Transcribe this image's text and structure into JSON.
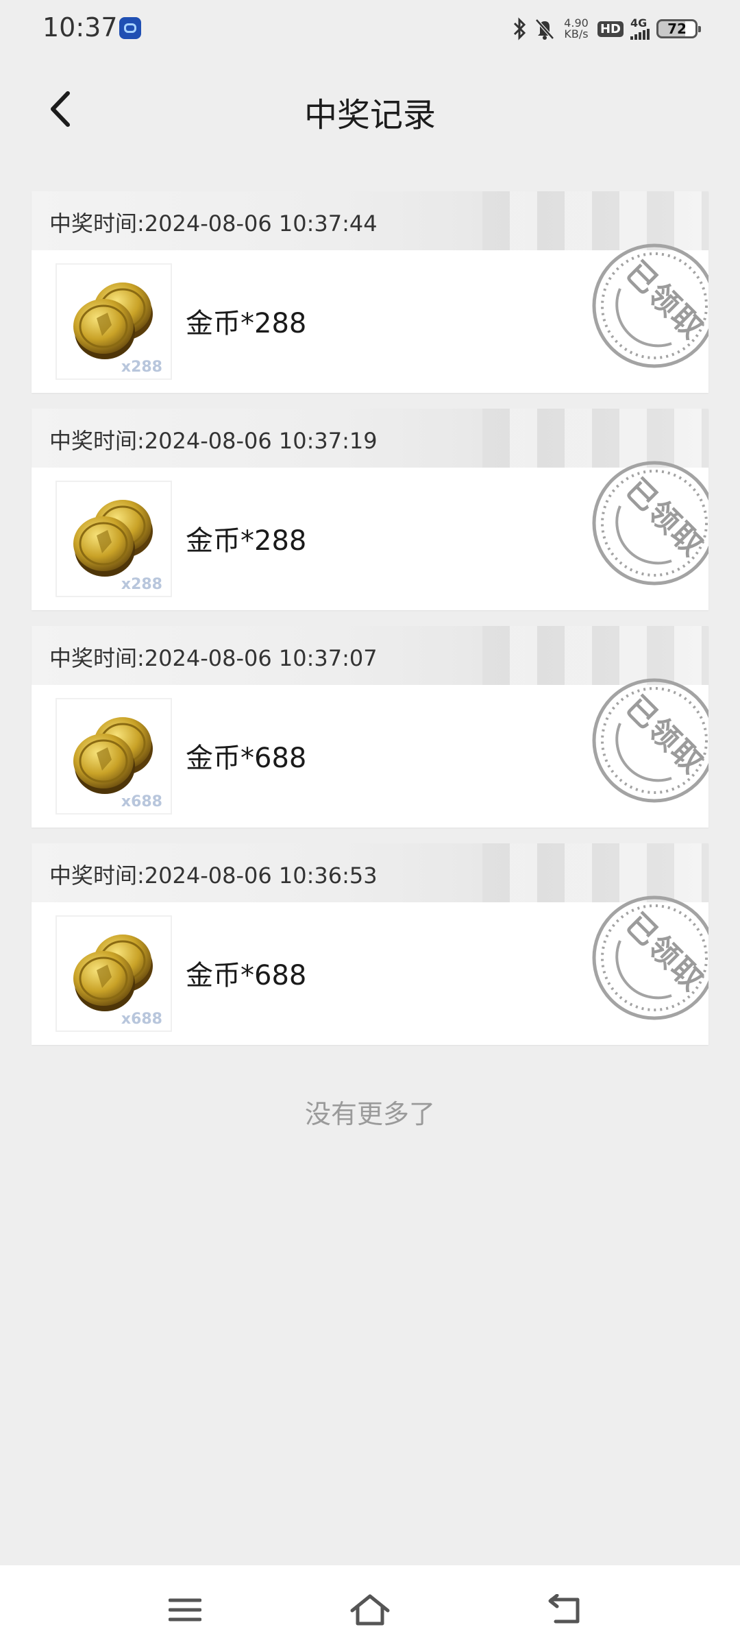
{
  "status_bar": {
    "time": "10:37",
    "speed_value": "4.90",
    "speed_unit": "KB/s",
    "hd_label": "HD",
    "network_label": "4G",
    "battery": "72",
    "icons": [
      "app-icon",
      "bluetooth-icon",
      "mute-icon",
      "signal-icon",
      "battery-icon"
    ]
  },
  "header": {
    "title": "中奖记录",
    "back_icon": "back-arrow-icon"
  },
  "records": [
    {
      "time": "中奖时间:2024-08-06 10:37:44",
      "prize": "金币*288",
      "count": "x288",
      "stamp": "已领取"
    },
    {
      "time": "中奖时间:2024-08-06 10:37:19",
      "prize": "金币*288",
      "count": "x288",
      "stamp": "已领取"
    },
    {
      "time": "中奖时间:2024-08-06 10:37:07",
      "prize": "金币*688",
      "count": "x688",
      "stamp": "已领取"
    },
    {
      "time": "中奖时间:2024-08-06 10:36:53",
      "prize": "金币*688",
      "count": "x688",
      "stamp": "已领取"
    }
  ],
  "footer_text": "没有更多了",
  "nav_bar": {
    "icons": [
      "menu-icon",
      "home-icon",
      "back-icon"
    ]
  },
  "colors": {
    "background": "#eeeeee",
    "card": "#ffffff",
    "stamp": "#9b9b9b",
    "coin": "#c9a227"
  }
}
